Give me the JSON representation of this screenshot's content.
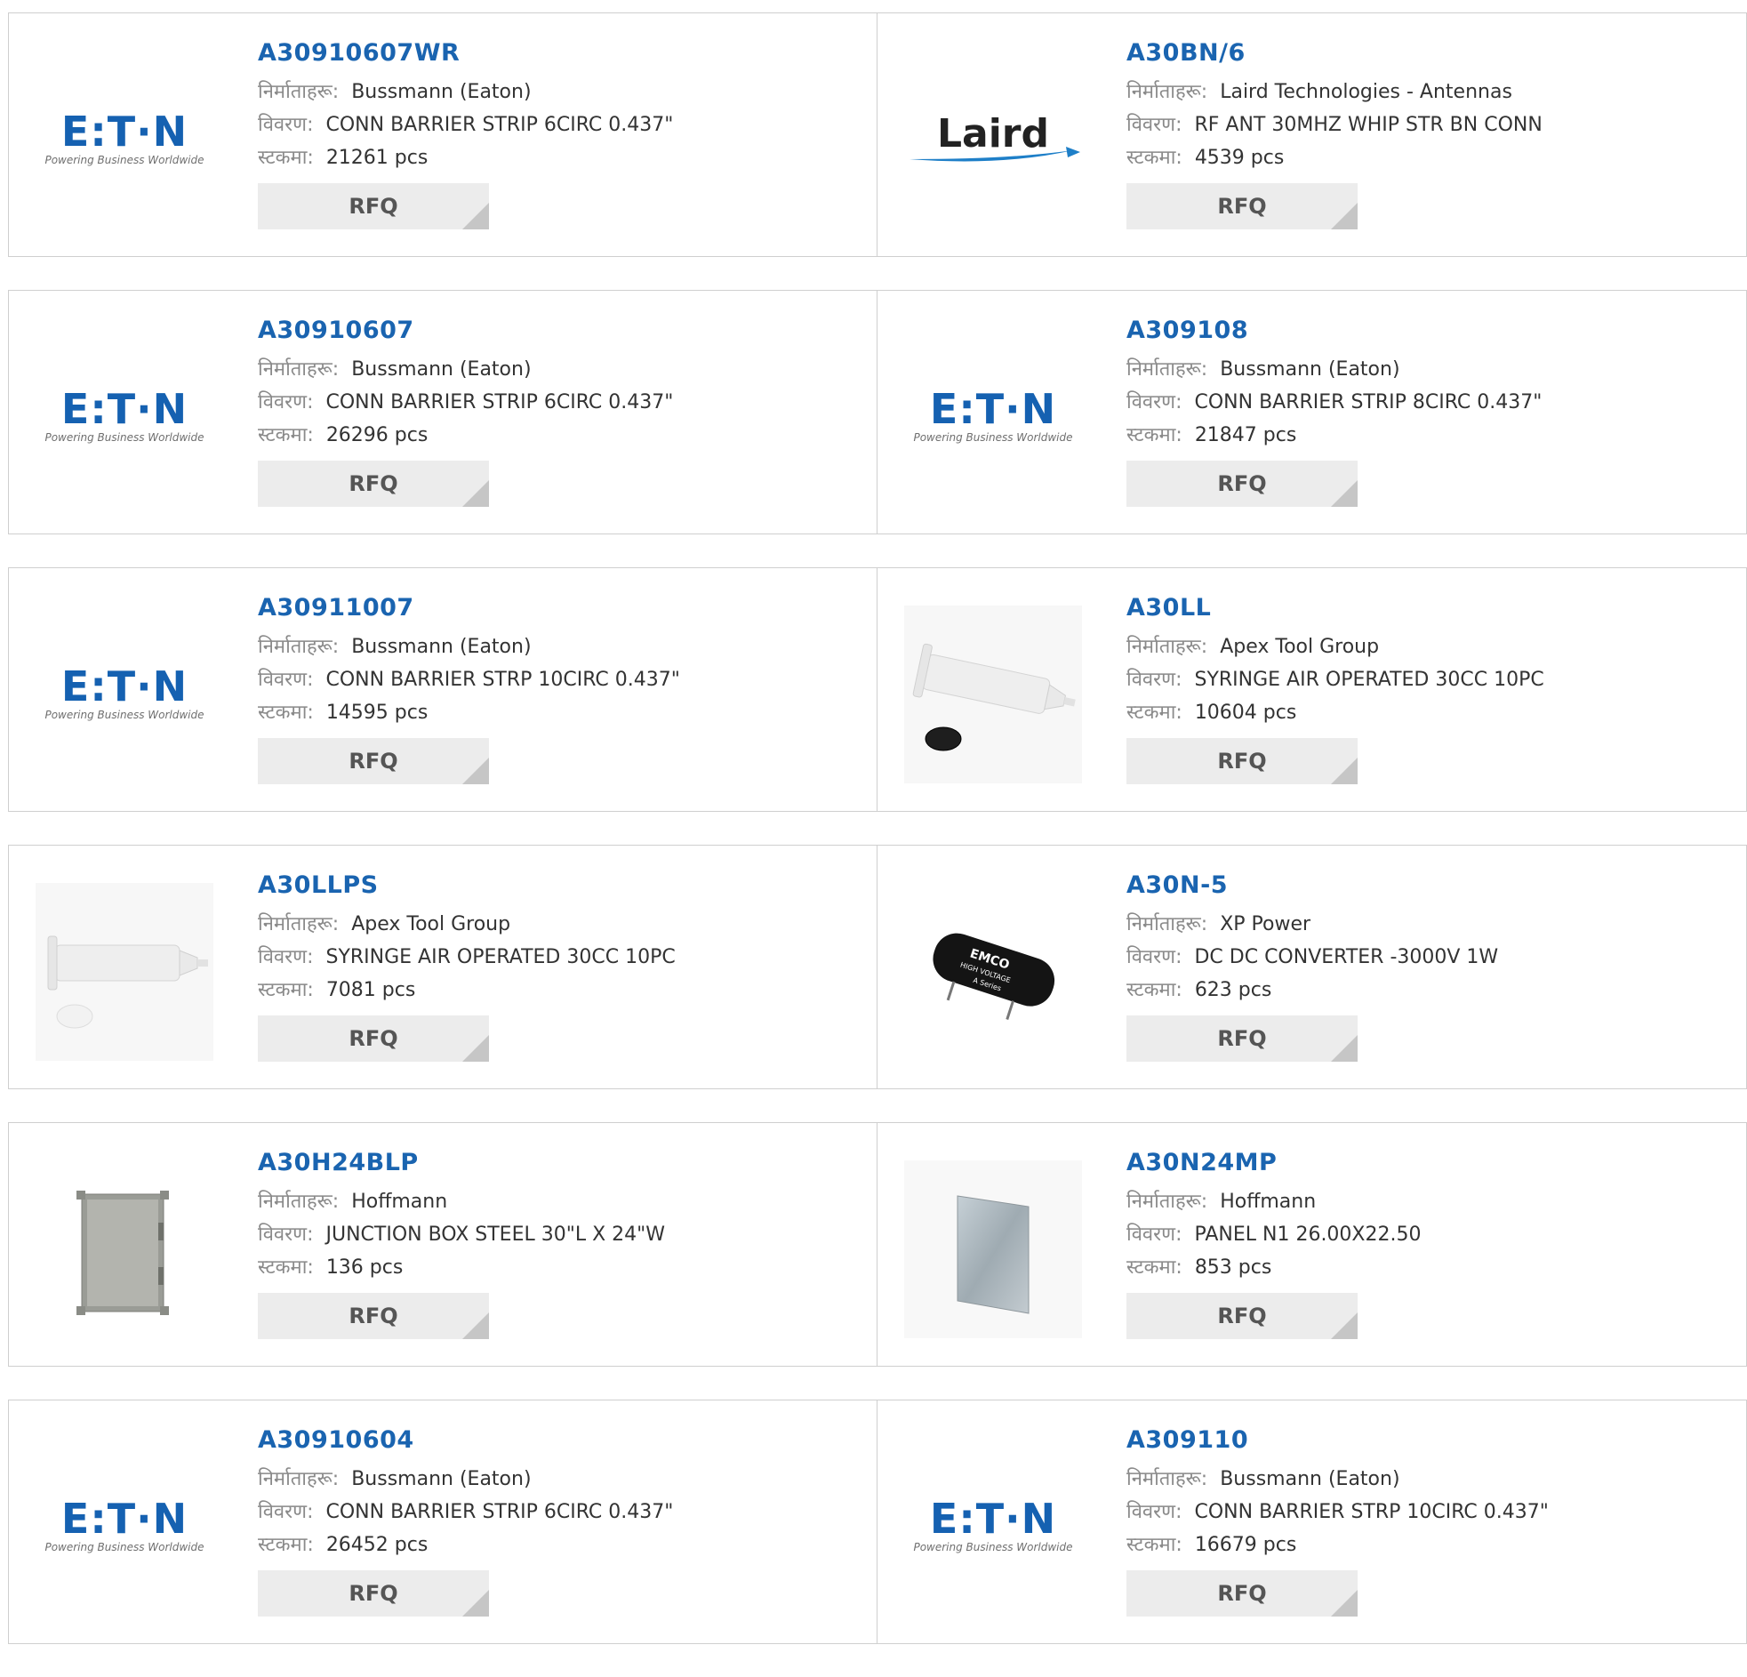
{
  "labels": {
    "manufacturer": "निर्माताहरू:",
    "description": "विवरण:",
    "stock": "स्टकमा:",
    "rfq": "RFQ"
  },
  "logo_text": {
    "eaton": "E:T·N",
    "eaton_tagline": "Powering Business Worldwide",
    "laird": "Laird",
    "emco_line1": "EMCO",
    "emco_line2": "HIGH VOLTAGE",
    "emco_line3": "A Series"
  },
  "colors": {
    "link": "#1a64b0",
    "eaton_blue": "#1561b1",
    "rfq_bg": "#ececec",
    "border": "#cfcfcf"
  },
  "products": [
    {
      "part": "A30910607WR",
      "manufacturer": "Bussmann (Eaton)",
      "description": "CONN BARRIER STRIP 6CIRC 0.437\"",
      "stock": "21261 pcs",
      "image": "eaton-logo"
    },
    {
      "part": "A30BN/6",
      "manufacturer": "Laird Technologies - Antennas",
      "description": "RF ANT 30MHZ WHIP STR BN CONN",
      "stock": "4539 pcs",
      "image": "laird-logo"
    },
    {
      "part": "A30910607",
      "manufacturer": "Bussmann (Eaton)",
      "description": "CONN BARRIER STRIP 6CIRC 0.437\"",
      "stock": "26296 pcs",
      "image": "eaton-logo"
    },
    {
      "part": "A309108",
      "manufacturer": "Bussmann (Eaton)",
      "description": "CONN BARRIER STRIP 8CIRC 0.437\"",
      "stock": "21847 pcs",
      "image": "eaton-logo"
    },
    {
      "part": "A30911007",
      "manufacturer": "Bussmann (Eaton)",
      "description": "CONN BARRIER STRP 10CIRC 0.437\"",
      "stock": "14595 pcs",
      "image": "eaton-logo"
    },
    {
      "part": "A30LL",
      "manufacturer": "Apex Tool Group",
      "description": "SYRINGE AIR OPERATED 30CC 10PC",
      "stock": "10604 pcs",
      "image": "syringe-dark-cap"
    },
    {
      "part": "A30LLPS",
      "manufacturer": "Apex Tool Group",
      "description": "SYRINGE AIR OPERATED 30CC 10PC",
      "stock": "7081 pcs",
      "image": "syringe-white-cap"
    },
    {
      "part": "A30N-5",
      "manufacturer": "XP Power",
      "description": "DC DC CONVERTER -3000V 1W",
      "stock": "623 pcs",
      "image": "emco-converter"
    },
    {
      "part": "A30H24BLP",
      "manufacturer": "Hoffmann",
      "description": "JUNCTION BOX STEEL 30\"L X 24\"W",
      "stock": "136 pcs",
      "image": "junction-box"
    },
    {
      "part": "A30N24MP",
      "manufacturer": "Hoffmann",
      "description": "PANEL N1 26.00X22.50",
      "stock": "853 pcs",
      "image": "steel-panel"
    },
    {
      "part": "A30910604",
      "manufacturer": "Bussmann (Eaton)",
      "description": "CONN BARRIER STRIP 6CIRC 0.437\"",
      "stock": "26452 pcs",
      "image": "eaton-logo"
    },
    {
      "part": "A309110",
      "manufacturer": "Bussmann (Eaton)",
      "description": "CONN BARRIER STRP 10CIRC 0.437\"",
      "stock": "16679 pcs",
      "image": "eaton-logo"
    }
  ]
}
